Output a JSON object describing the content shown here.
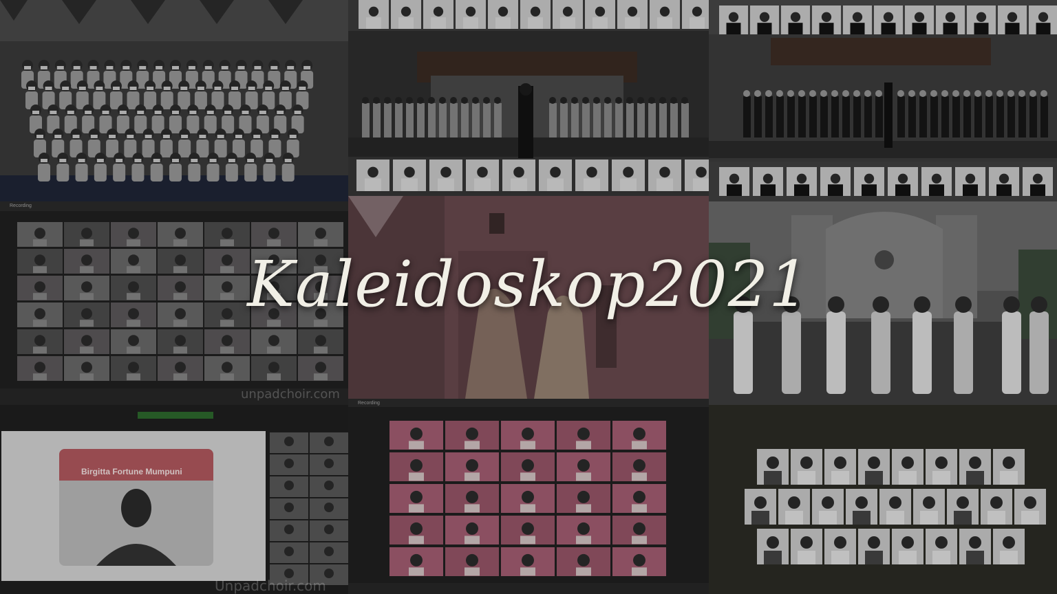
{
  "title": "Kaleidoskop2021",
  "watermark_1": "unpadchoir.com",
  "watermark_2": "Unpadchoir.com",
  "card_name": "Birgitta Fortune Mumpuni",
  "recording_label": "Recording",
  "colors": {
    "title": "#f1efe6",
    "zoom_bg": "#1e1e1e",
    "pink_tile": "#b1647a",
    "card_header": "#c0545c"
  }
}
